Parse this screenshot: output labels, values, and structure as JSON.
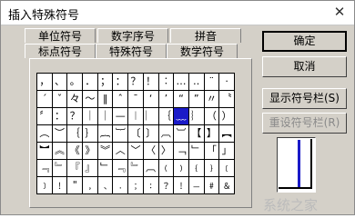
{
  "window": {
    "title": "插入特殊符号",
    "close_glyph": "✕"
  },
  "tabs": {
    "row1": [
      "单位符号",
      "数字序号",
      "拼音"
    ],
    "row2": [
      "标点符号",
      "特殊符号",
      "数学符号"
    ],
    "active": "标点符号"
  },
  "symbols": [
    [
      "，",
      "、",
      "。",
      "．",
      "；",
      "：",
      "？",
      "！",
      "︰",
      "…",
      "‥",
      "¨",
      "·"
    ],
    [
      "ˊ",
      "ˇ",
      "々",
      "～",
      "‖",
      "ˆ",
      "ˉ",
      "‘",
      "’",
      "“",
      "”",
      "〃",
      "〝"
    ],
    [
      "〞",
      "：",
      "？",
      "｜",
      "｜",
      "—",
      "︱",
      "︳",
      "｛",
      "﹏",
      "︴",
      "（",
      "）"
    ],
    [
      "︵",
      "︶",
      "｛",
      "｝",
      "︷",
      "︸",
      "〔",
      "〕",
      "︹",
      "︺",
      "【",
      "】",
      "︻"
    ],
    [
      "︼",
      "︽",
      "《",
      "》",
      "︾",
      "︿",
      "﹀",
      "〈",
      "〉",
      "﹁",
      "﹂",
      "「",
      "」"
    ],
    [
      "﹃",
      "﹄",
      "『",
      "』",
      "﹂",
      "﹃",
      "﹄",
      "︹",
      "﹙",
      "﹚",
      "﹛",
      "﹜",
      "﹝"
    ],
    [
      "﹞",
      "﹗",
      "\"",
      "﹐",
      "﹑",
      "﹒",
      "﹔",
      "﹕",
      "﹖",
      "﹗",
      "﹘",
      "﹟",
      "﹠"
    ]
  ],
  "selected_symbol": "﹏",
  "buttons": {
    "ok": "确定",
    "cancel": "取消",
    "show_toolbar": "显示符号栏(S)",
    "reset_toolbar": "重设符号栏(R)"
  },
  "watermark": "系统之家",
  "colors": {
    "selection": "#1a1ac8",
    "window_bg": "#d4d0c8"
  }
}
